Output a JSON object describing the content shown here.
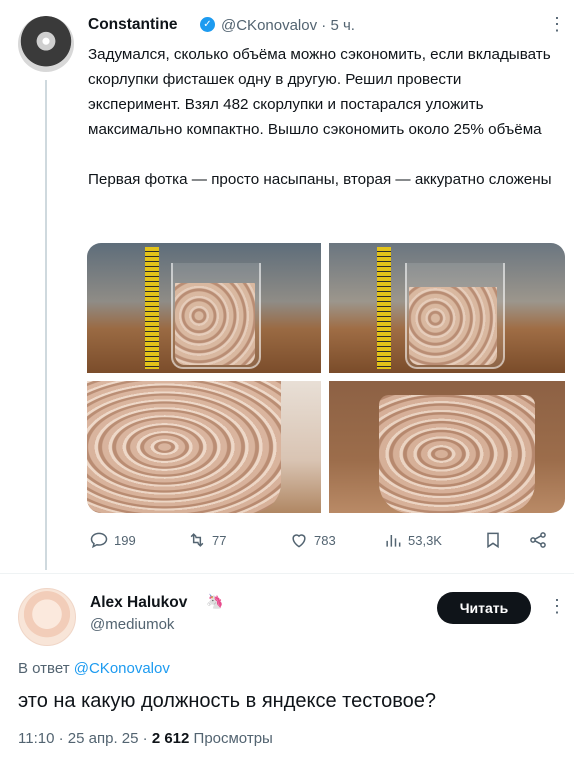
{
  "tweet": {
    "author_name": "Constantine",
    "author_handle": "@CKonovalov",
    "time": "5 ч.",
    "paragraph1": "Задумался, сколько объёма можно сэкономить, если вкладывать скорлупки фисташек одну в другую. Решил провести эксперимент. Взял 482 скорлупки и постарался уложить максимально компактно. Вышло сэкономить около 25% объёма",
    "paragraph2": "Первая фотка — просто насыпаны, вторая — аккуратно сложены",
    "stats": {
      "replies": "199",
      "retweets": "77",
      "likes": "783",
      "views": "53,3K"
    }
  },
  "reply": {
    "author_name": "Alex Halukov",
    "author_emoji": "🦄",
    "author_handle": "@mediumok",
    "follow_label": "Читать",
    "replying_prefix": "В ответ",
    "replying_to": "@CKonovalov",
    "text": "это на какую должность в яндексе тестовое?",
    "time": "11:10",
    "date": "25 апр. 25",
    "views_count": "2 612",
    "views_label": "Просмотры"
  },
  "colors": {
    "accent": "#1d9bf0",
    "muted": "#536471",
    "text": "#0f1419"
  }
}
